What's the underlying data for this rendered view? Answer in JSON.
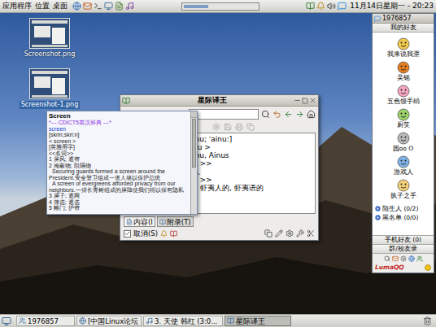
{
  "top_panel": {
    "menus": [
      "应用程序",
      "位置",
      "桌面"
    ],
    "clock": "11月14日星期一 - 20:23"
  },
  "desktop_icons": [
    {
      "label": "Screenshot.png",
      "selected": false
    },
    {
      "label": "Screenshot-1.png",
      "selected": true
    }
  ],
  "stardict": {
    "title": "星际译王",
    "definition_lines": [
      "lnu; ˈainu:]",
      "nu >",
      "Inu, Ainus",
      "u >>",
      "人",
      "e >>",
      "、虾夷人的, 虾夷语的"
    ],
    "tabs": [
      {
        "label": "内容(I",
        "selected": true
      },
      {
        "label": "附录(T)",
        "selected": false
      }
    ],
    "checkbox": {
      "label": "取消(S)",
      "checked": true
    }
  },
  "popup": {
    "lines": [
      {
        "text": "Screen",
        "kind": "heading"
      },
      {
        "text": "*--- CDICT5英汉辞典 ---*",
        "kind": "dict"
      },
      {
        "text": "screen",
        "kind": "word"
      },
      {
        "text": "[skrin;skri:n]",
        "kind": "text"
      },
      {
        "text": "< screen >",
        "kind": "text"
      },
      {
        "text": "[英雅用字]",
        "kind": "text"
      },
      {
        "text": "<<名词>>",
        "kind": "text"
      },
      {
        "text": "1 屏风; 遮帘",
        "kind": "text"
      },
      {
        "text": "2 掩蔽物; 阻隔物",
        "kind": "text"
      },
      {
        "text": "Securing guards formed a screen around the",
        "kind": "example"
      },
      {
        "text": "President.安全警卫组成一道人墙以保护总统",
        "kind": "text"
      },
      {
        "text": "A screen of evergreens afforded privacy from our",
        "kind": "example"
      },
      {
        "text": "neighbors.一排长青树组成的屏障使我们得以保有隐私",
        "kind": "text"
      },
      {
        "text": "3 屏子; 遮网",
        "kind": "text"
      },
      {
        "text": "4 筛选; 遮选",
        "kind": "text"
      },
      {
        "text": "5 帷门; 护帘",
        "kind": "text"
      }
    ]
  },
  "buddy_list": {
    "title": "1976857",
    "group": "我的好友",
    "buddies": [
      {
        "name": "我来说我歪"
      },
      {
        "name": "吴铭"
      },
      {
        "name": "五色馒手绢"
      },
      {
        "name": "厨笑"
      },
      {
        "name": "园oo O"
      },
      {
        "name": "游戏人"
      },
      {
        "name": "执子之手"
      }
    ],
    "collapsed_groups": [
      "陌生人 (0/2)",
      "黑名单 (0/0)"
    ],
    "buttons": [
      "手机好友 (0)",
      "群/校友录"
    ],
    "logo": "LumaQQ"
  },
  "taskbar": {
    "tasks": [
      {
        "label": "1976857",
        "selected": false
      },
      {
        "label": "[中国Linux论坛",
        "selected": false
      },
      {
        "label": "3. 天使 韩红 (3:0...",
        "selected": false
      },
      {
        "label": "星际译王",
        "selected": true
      }
    ]
  }
}
